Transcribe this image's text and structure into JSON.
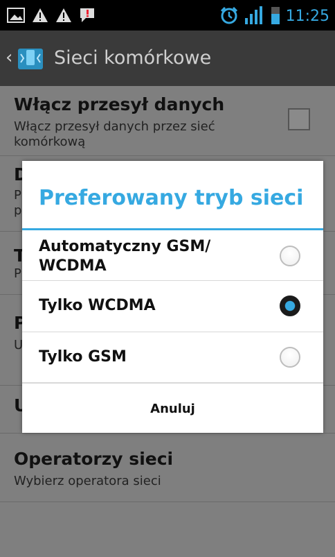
{
  "status_bar": {
    "time": "11:25",
    "icons": [
      "image-icon",
      "warning-icon",
      "warning-icon",
      "notification-icon",
      "alarm-icon",
      "signal-icon",
      "battery-icon"
    ]
  },
  "action_bar": {
    "title": "Sieci komórkowe",
    "icon": "mobile-network-icon"
  },
  "settings": {
    "data_enabled": {
      "title": "Włącz przesył danych",
      "summary": "Włącz przesył danych przez sieć komórkową",
      "checked": false
    },
    "item2_title_partial": "D",
    "item2_summary_partial": "P\np",
    "item3_title_partial": "T",
    "item3_summary_partial": "P",
    "item4_title_partial": "P",
    "item4_summary_partial": "U",
    "item5_title_partial": "U",
    "operators": {
      "title": "Operatorzy sieci",
      "summary": "Wybierz operatora sieci"
    }
  },
  "dialog": {
    "title": "Preferowany tryb sieci",
    "options": [
      {
        "label": "Automatyczny GSM/\nWCDMA",
        "selected": false
      },
      {
        "label": "Tylko WCDMA",
        "selected": true
      },
      {
        "label": "Tylko GSM",
        "selected": false
      }
    ],
    "cancel": "Anuluj"
  },
  "colors": {
    "accent": "#36a9e1",
    "dim_background": "#7f7f7f"
  }
}
